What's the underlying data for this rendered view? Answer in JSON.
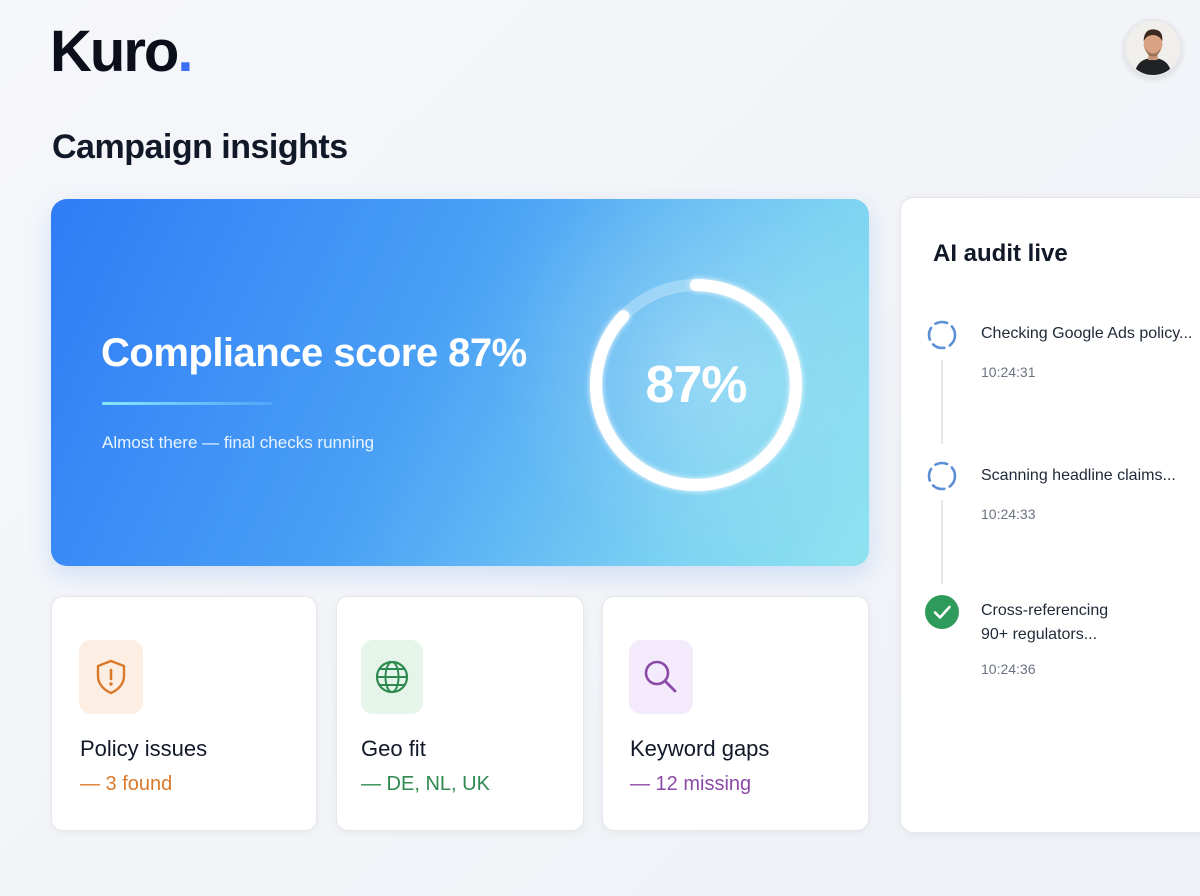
{
  "brand": {
    "name": "Kuro",
    "dot": "."
  },
  "user": {
    "avatar_alt": "User avatar"
  },
  "page": {
    "title": "Campaign insights"
  },
  "hero": {
    "title": "Compliance score 87%",
    "subtitle": "Almost there — final checks running",
    "score_label": "87%",
    "score_value": 0.87
  },
  "cards": [
    {
      "title": "Policy issues",
      "detail": "— 3 found",
      "icon": "shield-alert-icon",
      "color": "#d97a2b",
      "bg": "#fdeee4"
    },
    {
      "title": "Geo fit",
      "detail": "— DE, NL, UK",
      "icon": "globe-icon",
      "color": "#2f8a4f",
      "bg": "#e6f5ea"
    },
    {
      "title": "Keyword gaps",
      "detail": "— 12 missing",
      "icon": "search-icon",
      "color": "#8b4aa8",
      "bg": "#f3eafb"
    }
  ],
  "audit": {
    "title": "AI audit live",
    "steps": [
      {
        "text": "Checking Google Ads policy...",
        "time": "10:24:31",
        "status": "in-progress"
      },
      {
        "text": "Scanning headline claims...",
        "time": "10:24:33",
        "status": "in-progress"
      },
      {
        "text": "Cross-referencing",
        "text2": "90+ regulators...",
        "time": "10:24:36",
        "status": "done"
      }
    ]
  },
  "colors": {
    "accent": "#3b6ff5",
    "success": "#2f9b5a",
    "pending": "#5b8fd6"
  }
}
